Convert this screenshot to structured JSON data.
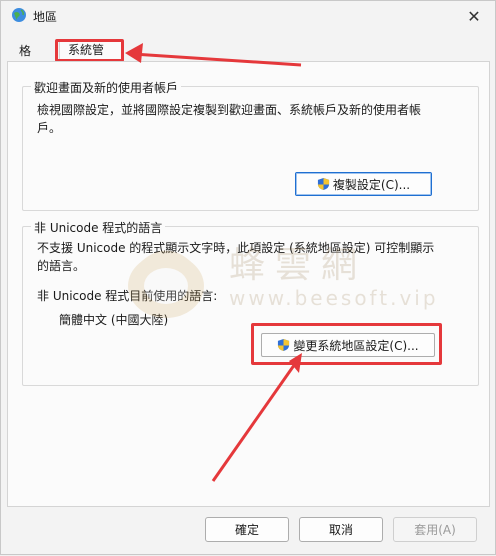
{
  "window": {
    "title": "地區"
  },
  "tabs": [
    {
      "label": "格式"
    },
    {
      "label": "系統管理"
    }
  ],
  "welcome_group": {
    "title": "歡迎畫面及新的使用者帳戶",
    "description_line1": "檢視國際設定，並將國際設定複製到歡迎畫面、系統帳戶及新的使用者帳",
    "description_line2": "戶。",
    "copy_button": "複製設定(C)..."
  },
  "unicode_group": {
    "title": "非 Unicode 程式的語言",
    "description_line1": "不支援 Unicode 的程式顯示文字時，此項設定 (系統地區設定) 可控制顯示",
    "description_line2": "的語言。",
    "current_label": "非 Unicode 程式目前使用的語言:",
    "current_value": "簡體中文 (中國大陸)",
    "change_button": "變更系統地區設定(C)..."
  },
  "footer": {
    "ok": "確定",
    "cancel": "取消",
    "apply": "套用(A)"
  },
  "watermark": {
    "line1": "蜂雲網",
    "line2": "www.beesoft.vip"
  },
  "colors": {
    "highlight": "#e5383b",
    "focus_border": "#1f6fd1"
  }
}
